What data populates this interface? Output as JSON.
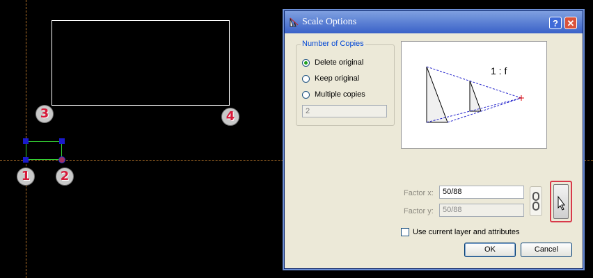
{
  "dialog": {
    "title": "Scale Options",
    "title_icon": "scale-tool-icon",
    "help_label": "?",
    "close_label": "✕"
  },
  "copies": {
    "group_title": "Number of Copies",
    "options": [
      {
        "label": "Delete original",
        "checked": true
      },
      {
        "label": "Keep original",
        "checked": false
      },
      {
        "label": "Multiple copies",
        "checked": false
      }
    ],
    "count_value": "2"
  },
  "preview": {
    "ratio_label": "1 : f"
  },
  "factors": {
    "x_label": "Factor x:",
    "x_value": "50/88",
    "y_label": "Factor y:",
    "y_value": "50/88"
  },
  "use_layer": {
    "label": "Use current layer and attributes",
    "checked": false
  },
  "buttons": {
    "ok": "OK",
    "cancel": "Cancel"
  },
  "canvas": {
    "badges": [
      "1",
      "2",
      "3",
      "4"
    ],
    "accent_colors": {
      "guide": "#b8762a",
      "selection": "#33cc33",
      "handle": "#1a1acc",
      "badge_text": "#d61a3a",
      "highlight": "#d8394a"
    }
  }
}
